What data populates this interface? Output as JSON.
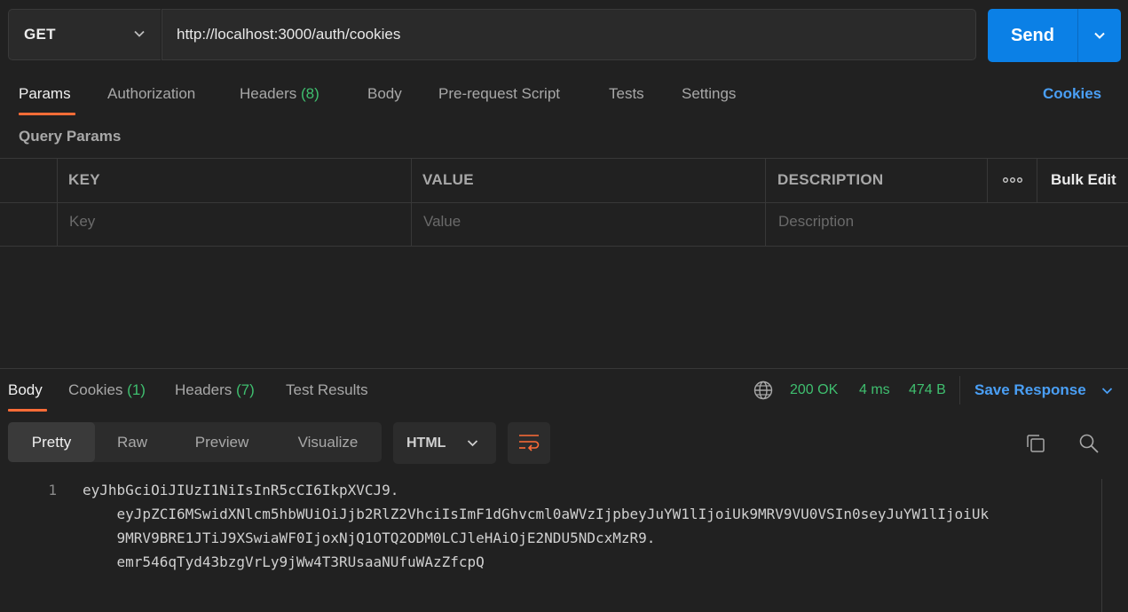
{
  "request": {
    "method": "GET",
    "url": "http://localhost:3000/auth/cookies",
    "send_label": "Send"
  },
  "request_tabs": [
    {
      "label": "Params",
      "count": ""
    },
    {
      "label": "Authorization",
      "count": ""
    },
    {
      "label": "Headers",
      "count": "(8)"
    },
    {
      "label": "Body",
      "count": ""
    },
    {
      "label": "Pre-request Script",
      "count": ""
    },
    {
      "label": "Tests",
      "count": ""
    },
    {
      "label": "Settings",
      "count": ""
    }
  ],
  "cookies_link": "Cookies",
  "query_params": {
    "title": "Query Params",
    "headers": [
      "KEY",
      "VALUE",
      "DESCRIPTION"
    ],
    "more_icon": "ooo",
    "bulk_edit": "Bulk Edit",
    "placeholders": [
      "Key",
      "Value",
      "Description"
    ]
  },
  "response": {
    "tabs": [
      {
        "label": "Body",
        "count": ""
      },
      {
        "label": "Cookies",
        "count": "(1)"
      },
      {
        "label": "Headers",
        "count": "(7)"
      },
      {
        "label": "Test Results",
        "count": ""
      }
    ],
    "status": "200 OK",
    "time": "4 ms",
    "size": "474 B",
    "save_label": "Save Response",
    "view_modes": [
      "Pretty",
      "Raw",
      "Preview",
      "Visualize"
    ],
    "format": "HTML",
    "line_number": "1",
    "body_lines": [
      "eyJhbGciOiJIUzI1NiIsInR5cCI6IkpXVCJ9.",
      "    eyJpZCI6MSwidXNlcm5hbWUiOiJjb2RlZ2VhciIsImF1dGhvcml0aWVzIjpbeyJuYW1lIjoiUk9MRV9VU0VSIn0seyJuYW1lIjoiUk",
      "    9MRV9BRE1JTiJ9XSwiaWF0IjoxNjQ1OTQ2ODM0LCJleHAiOjE2NDU5NDcxMzR9.",
      "    emr546qTyd43bzgVrLy9jWw4T3RUsaaNUfuWAzZfcpQ"
    ]
  },
  "colors": {
    "accent_orange": "#ff6c37",
    "send_blue": "#0b80e6",
    "link_blue": "#4a9ff5",
    "success_green": "#3fbf6f"
  }
}
